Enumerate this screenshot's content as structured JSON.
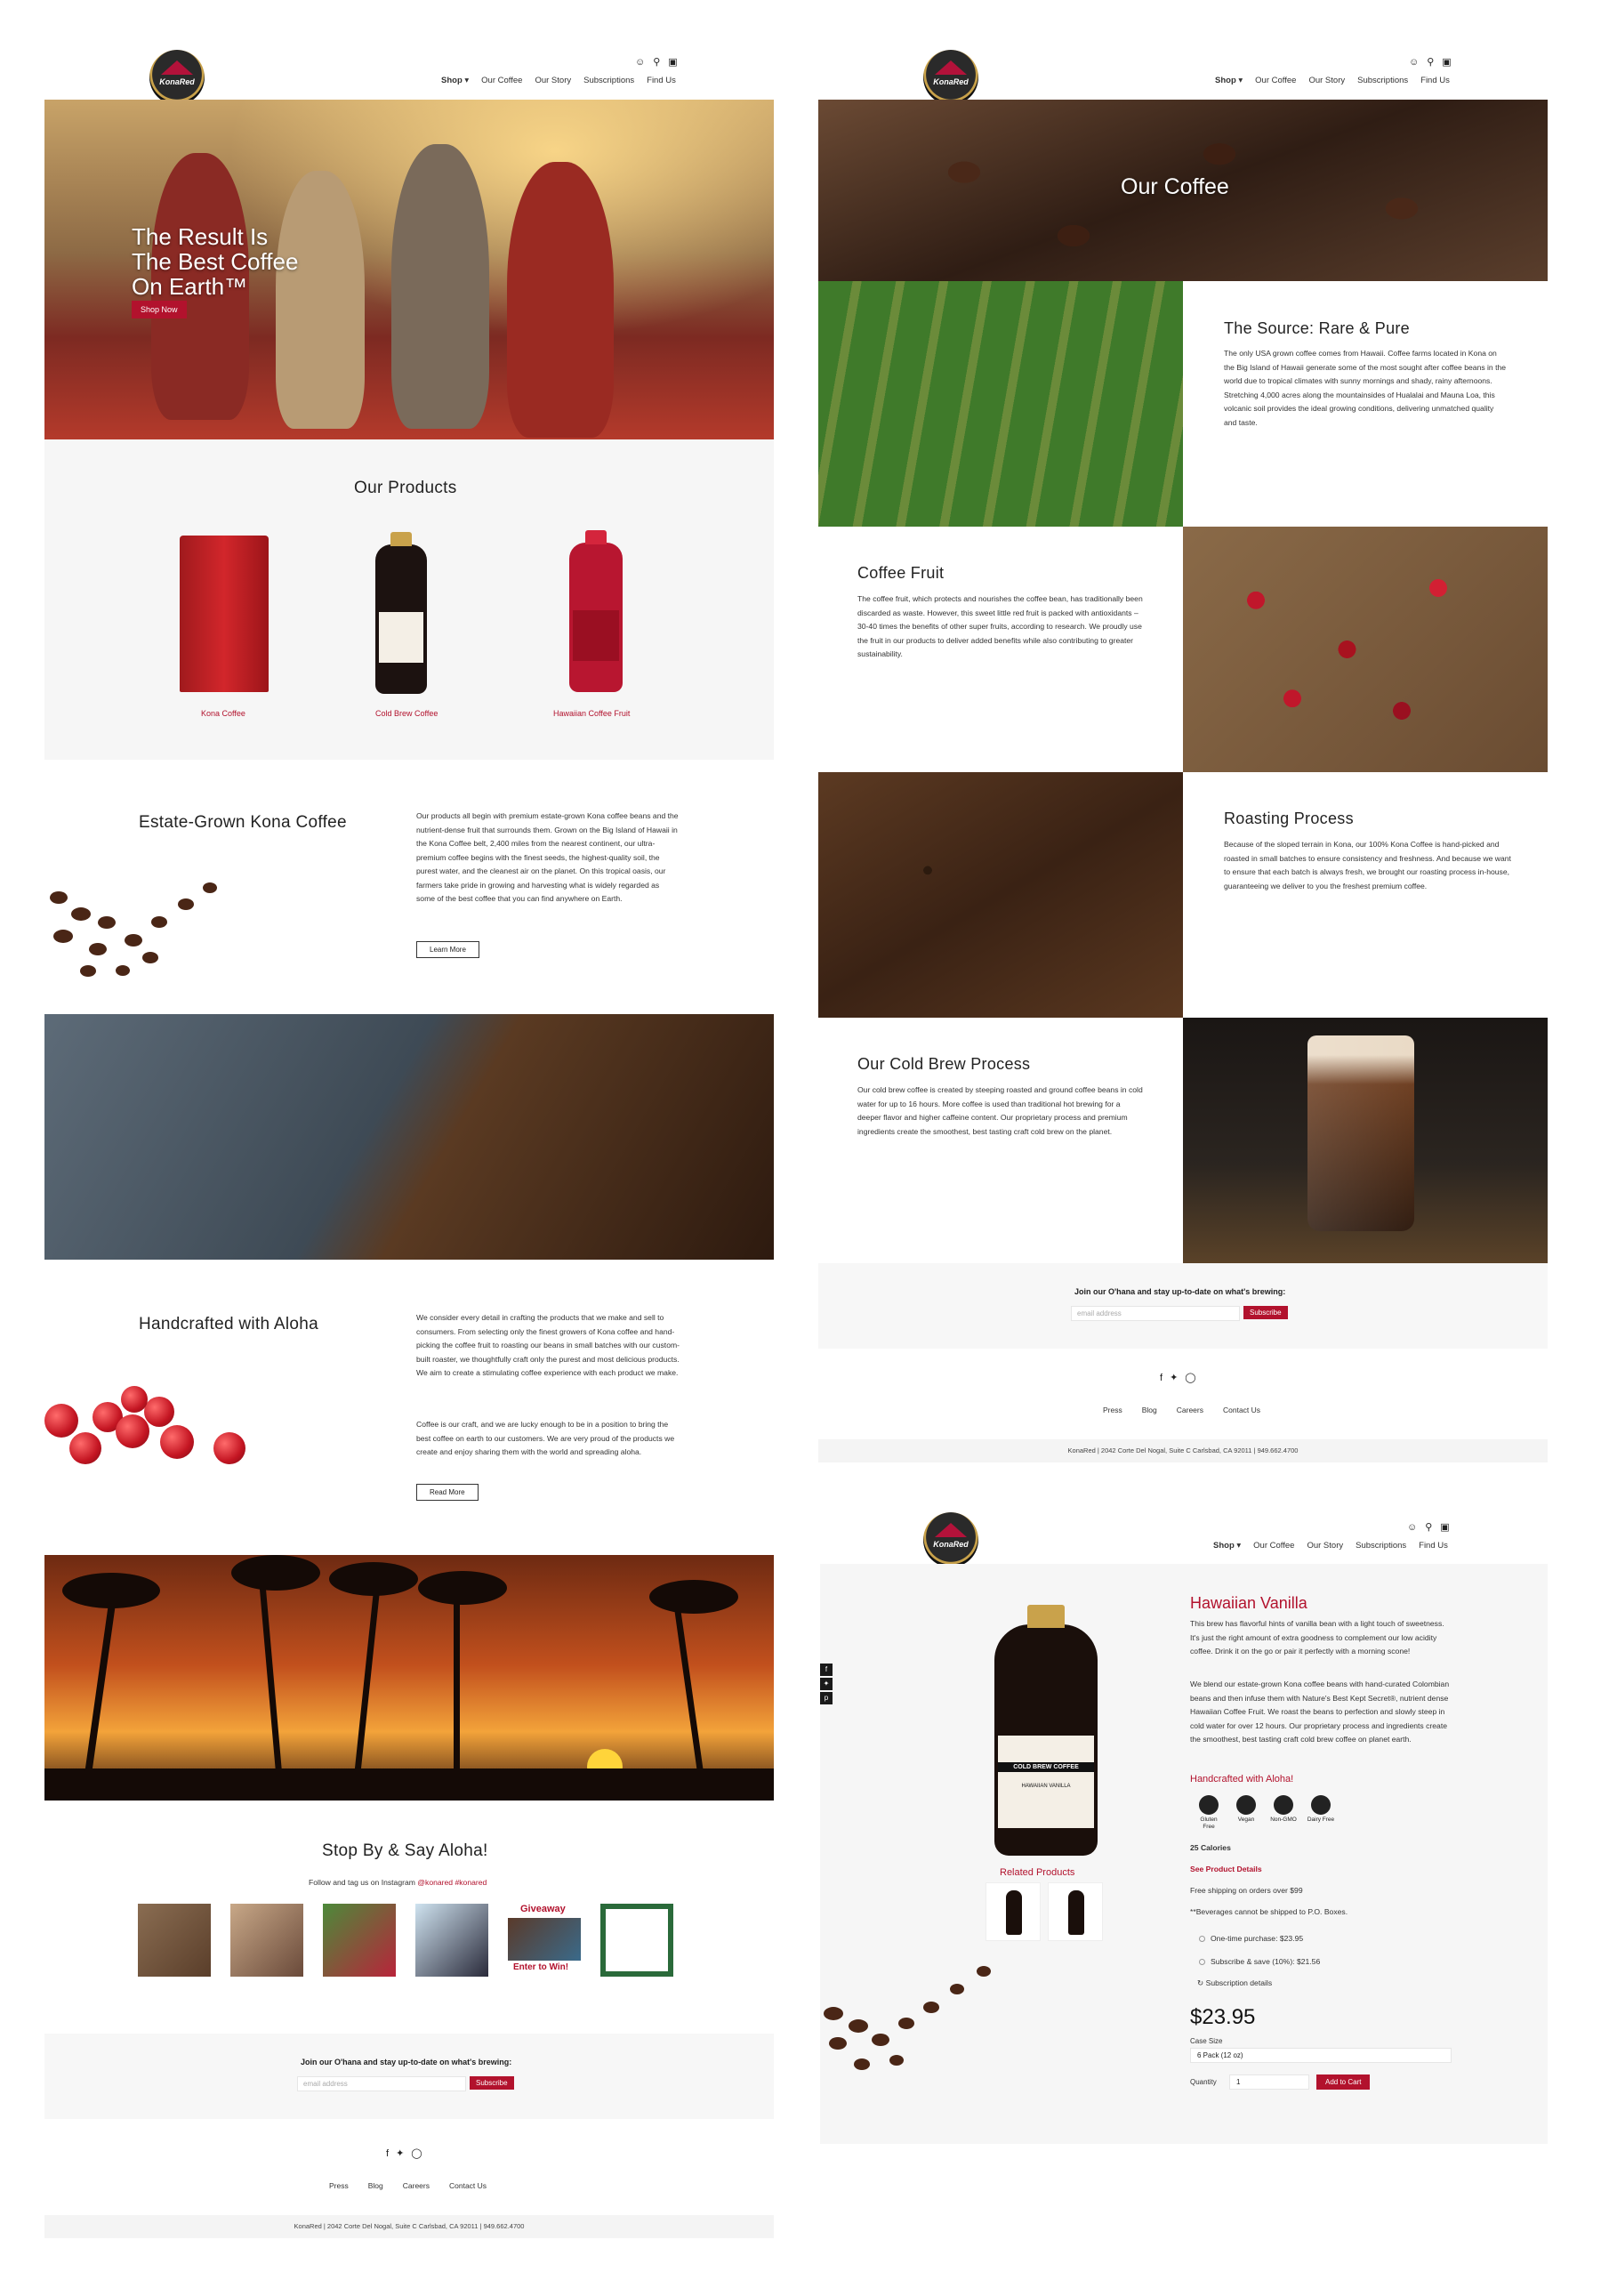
{
  "brand": {
    "logo_text": "KonaRed",
    "accent": "#b2122d"
  },
  "nav": {
    "items": [
      "Shop ▾",
      "Our Coffee",
      "Our Story",
      "Subscriptions",
      "Find Us"
    ]
  },
  "header_icons": [
    "user-icon",
    "search-icon",
    "cart-icon"
  ],
  "home": {
    "hero": {
      "title_lines": [
        "The Result Is",
        "The Best Coffee",
        "On Earth™"
      ],
      "button": "Shop Now"
    },
    "products": {
      "heading": "Our Products",
      "items": [
        {
          "label": "Kona Coffee"
        },
        {
          "label": "Cold Brew Coffee"
        },
        {
          "label": "Hawaiian Coffee Fruit"
        }
      ]
    },
    "estate": {
      "heading": "Estate-Grown Kona Coffee",
      "body": "Our products all begin with premium estate-grown Kona coffee beans and the nutrient-dense fruit that surrounds them. Grown on the Big Island of Hawaii in the Kona Coffee belt, 2,400 miles from the nearest continent, our ultra-premium coffee begins with the finest seeds, the highest-quality soil, the purest water, and the cleanest air on the planet. On this tropical oasis, our farmers take pride in growing and harvesting what is widely regarded as some of the best coffee that you can find anywhere on Earth.",
      "button": "Learn More"
    },
    "aloha": {
      "heading": "Handcrafted with Aloha",
      "body1": "We consider every detail in crafting the products that we make and sell to consumers. From selecting only the finest growers of Kona coffee and hand-picking the coffee fruit to roasting our beans in small batches with our custom-built roaster, we thoughtfully craft only the purest and most delicious products. We aim to create a stimulating coffee experience with each product we make.",
      "body2": "Coffee is our craft, and we are lucky enough to be in a position to bring the best coffee on earth to our customers. We are very proud of the products we create and enjoy sharing them with the world and spreading aloha.",
      "button": "Read More"
    },
    "instagram": {
      "heading": "Stop By & Say Aloha!",
      "follow_prefix": "Follow and tag us on Instagram ",
      "handles": "@konared #konared",
      "giveaway_top": "Giveaway",
      "giveaway_bottom": "Enter to Win!"
    }
  },
  "newsletter": {
    "title": "Join our O'hana and stay up-to-date on what's brewing:",
    "placeholder": "email address",
    "button": "Subscribe"
  },
  "footer": {
    "social": [
      "facebook-icon",
      "twitter-icon",
      "instagram-icon"
    ],
    "links": [
      "Press",
      "Blog",
      "Careers",
      "Contact Us"
    ],
    "address": "KonaRed | 2042 Corte Del Nogal, Suite C Carlsbad, CA 92011 | 949.662.4700"
  },
  "our_coffee": {
    "banner_title": "Our Coffee",
    "source": {
      "heading": "The Source: Rare & Pure",
      "body": "The only USA grown coffee comes from Hawaii. Coffee farms located in Kona on the Big Island of Hawaii generate some of the most sought after coffee beans in the world due to tropical climates with sunny mornings and shady, rainy afternoons. Stretching 4,000 acres along the mountainsides of Hualalai and Mauna Loa, this volcanic soil provides the ideal growing conditions, delivering unmatched quality and taste."
    },
    "fruit": {
      "heading": "Coffee Fruit",
      "body": "The coffee fruit, which protects and nourishes the coffee bean, has traditionally been discarded as waste. However, this sweet little red fruit is packed with antioxidants – 30-40 times the benefits of other super fruits, according to research. We proudly use the fruit in our products to deliver added benefits while also contributing to greater sustainability."
    },
    "roasting": {
      "heading": "Roasting Process",
      "body": "Because of the sloped terrain in Kona, our 100% Kona Coffee is hand-picked and roasted in small batches to ensure consistency and freshness. And because we want to ensure that each batch is always fresh, we brought our roasting process in-house, guaranteeing we deliver to you the freshest premium coffee."
    },
    "cold_brew": {
      "heading": "Our Cold Brew Process",
      "body": "Our cold brew coffee is created by steeping roasted and ground coffee beans in cold water for up to 16 hours. More coffee is used than traditional hot brewing for a deeper flavor and higher caffeine content. Our proprietary process and premium ingredients create the smoothest, best tasting craft cold brew on the planet."
    }
  },
  "product_page": {
    "title": "Hawaiian Vanilla",
    "desc1": "This brew has flavorful hints of vanilla bean with a light touch of sweetness. It's just the right amount of extra goodness to complement our low acidity coffee. Drink it on the go or pair it perfectly with a morning scone!",
    "desc2": "We blend our estate-grown Kona coffee beans with hand-curated Colombian beans and then infuse them with Nature's Best Kept Secret®, nutrient dense Hawaiian Coffee Fruit. We roast the beans to perfection and slowly steep in cold water for over 12 hours. Our proprietary process and ingredients create the smoothest, best tasting craft cold brew coffee on planet earth.",
    "subheading": "Handcrafted with Aloha!",
    "badges": [
      "Gluten Free",
      "Vegan",
      "Non-GMO",
      "Dairy Free"
    ],
    "calories": "25 Calories",
    "details_link": "See Product Details",
    "shipping": "Free shipping on orders over $99",
    "po_note": "**Beverages cannot be shipped to P.O. Boxes.",
    "options": [
      "One-time purchase: $23.95",
      "Subscribe & save (10%): $21.56"
    ],
    "subscription_details": "Subscription details",
    "price": "$23.95",
    "case_label": "Case Size",
    "case_value": "6 Pack (12 oz)",
    "quantity_label": "Quantity",
    "quantity_value": "1",
    "add_to_cart": "Add to Cart",
    "related": "Related Products",
    "bottle_label_top": "COLD BREW COFFEE",
    "bottle_label_bottom": "HAWAIIAN VANILLA",
    "share": [
      "facebook-icon",
      "twitter-icon",
      "pinterest-icon"
    ]
  }
}
